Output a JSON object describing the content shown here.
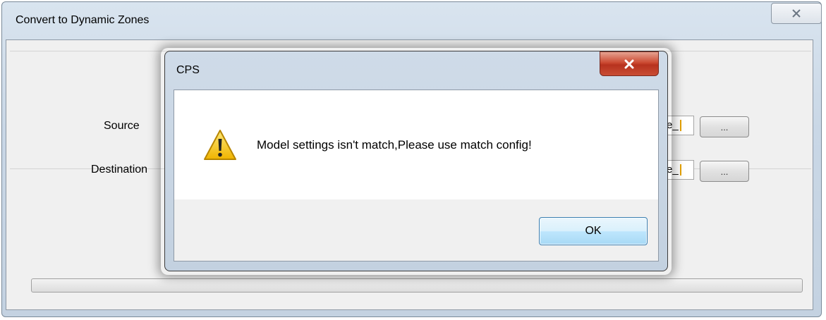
{
  "main_window": {
    "title": "Convert to Dynamic Zones",
    "close_icon": "close-icon",
    "source_label": "Source",
    "source_value": "e_",
    "destination_label": "Destination",
    "destination_value": "e_",
    "browse_label": "...",
    "progress_percent": 0
  },
  "message_box": {
    "title": "CPS",
    "close_icon": "close-icon",
    "icon": "warning-icon",
    "message": "Model settings isn't match,Please use match config!",
    "ok_label": "OK"
  },
  "colors": {
    "close_button_red": "#c94d34",
    "warning_yellow": "#f5c518",
    "ok_button_border": "#3c7fb1"
  }
}
